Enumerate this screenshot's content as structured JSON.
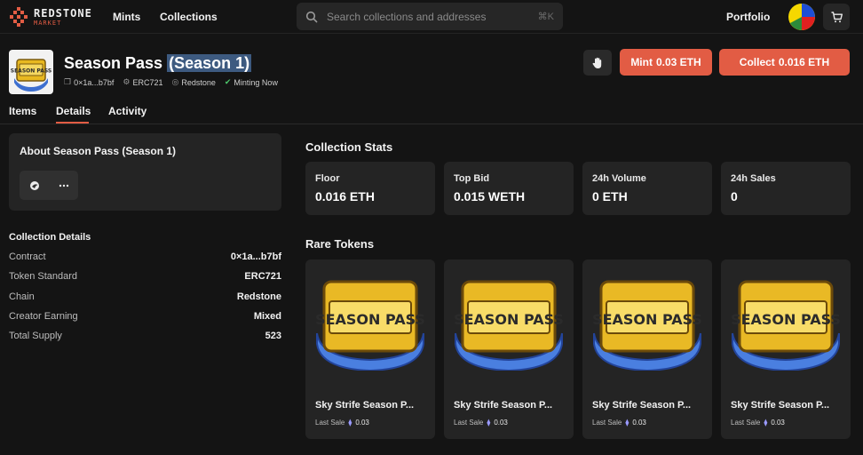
{
  "nav": {
    "brand_line1": "REDSTONE",
    "brand_line2": "MARKET",
    "mints": "Mints",
    "collections": "Collections",
    "search_placeholder": "Search collections and addresses",
    "search_shortcut": "⌘K",
    "portfolio": "Portfolio"
  },
  "collection": {
    "title_main": "Season Pass",
    "title_highlight": "(Season 1)",
    "contract_short": "0×1a...b7bf",
    "standard": "ERC721",
    "chain": "Redstone",
    "status": "Minting Now",
    "badge_text": "SEASON PASS"
  },
  "actions": {
    "mint_label": "Mint",
    "mint_price": "0.03 ETH",
    "collect_label": "Collect",
    "collect_price": "0.016 ETH"
  },
  "tabs": [
    {
      "label": "Items"
    },
    {
      "label": "Details"
    },
    {
      "label": "Activity"
    }
  ],
  "about": {
    "heading": "About Season Pass (Season 1)"
  },
  "details": {
    "heading": "Collection Details",
    "rows": [
      {
        "key": "Contract",
        "value": "0×1a...b7bf"
      },
      {
        "key": "Token Standard",
        "value": "ERC721"
      },
      {
        "key": "Chain",
        "value": "Redstone"
      },
      {
        "key": "Creator Earning",
        "value": "Mixed"
      },
      {
        "key": "Total Supply",
        "value": "523"
      }
    ]
  },
  "stats": {
    "heading": "Collection Stats",
    "items": [
      {
        "label": "Floor",
        "value": "0.016 ETH"
      },
      {
        "label": "Top Bid",
        "value": "0.015 WETH"
      },
      {
        "label": "24h Volume",
        "value": "0 ETH"
      },
      {
        "label": "24h Sales",
        "value": "0"
      }
    ]
  },
  "rare": {
    "heading": "Rare Tokens",
    "items": [
      {
        "name": "Sky Strife Season P...",
        "sale_label": "Last Sale",
        "sale_value": "0.03"
      },
      {
        "name": "Sky Strife Season P...",
        "sale_label": "Last Sale",
        "sale_value": "0.03"
      },
      {
        "name": "Sky Strife Season P...",
        "sale_label": "Last Sale",
        "sale_value": "0.03"
      },
      {
        "name": "Sky Strife Season P...",
        "sale_label": "Last Sale",
        "sale_value": "0.03"
      }
    ]
  },
  "colors": {
    "accent": "#e25c44",
    "background": "#141414",
    "card": "#242424"
  }
}
